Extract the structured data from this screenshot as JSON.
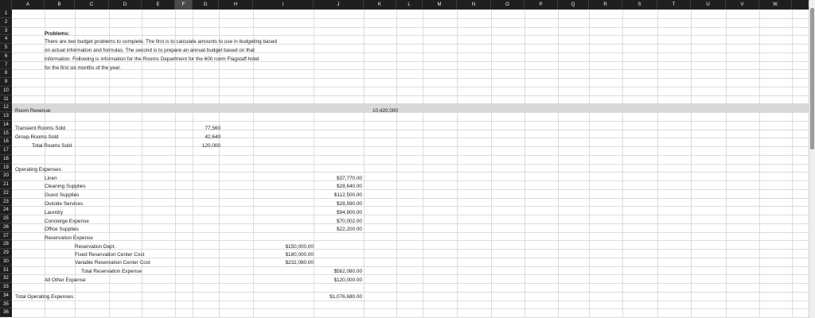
{
  "columns": [
    "A",
    "B",
    "C",
    "D",
    "E",
    "F",
    "G",
    "H",
    "I",
    "J",
    "K",
    "L",
    "M",
    "N",
    "O",
    "P",
    "Q",
    "R",
    "S",
    "T",
    "U",
    "V",
    "W",
    "X"
  ],
  "selected_column": "F",
  "rows": [
    "1",
    "2",
    "3",
    "4",
    "5",
    "6",
    "7",
    "8",
    "9",
    "10",
    "11",
    "12",
    "13",
    "14",
    "15",
    "16",
    "17",
    "18",
    "19",
    "20",
    "21",
    "22",
    "23",
    "24",
    "25",
    "26",
    "27",
    "28",
    "29",
    "30",
    "31",
    "32",
    "33",
    "34",
    "35",
    "36"
  ],
  "problem": {
    "heading": "Problems:",
    "line1": "There are two budget problems to complete. The first is to calculate amounts to use in budgeting based",
    "line2": "on actual information and formulas. The second is to prepare an annual budget based on that",
    "line3": "information. Following is information for the Rooms Department for the 600 room Flagstaff hotel",
    "line4": "for the first six months of the year."
  },
  "room_revenue": {
    "label": "Room Revenue",
    "value": "10,420,000"
  },
  "rooms": {
    "transient_label": "Transient Rooms Sold",
    "transient_value": "77,560",
    "group_label": "Group Rooms Sold",
    "group_value": "42,640",
    "total_label": "Total Rooms Sold",
    "total_value": "120,000"
  },
  "expenses": {
    "heading": "Operating Expenses",
    "linen_label": "Linen",
    "linen_value": "$37,770.00",
    "cleaning_label": "Cleaning Supplies",
    "cleaning_value": "$28,640.00",
    "guest_label": "Guest Supplies",
    "guest_value": "$112,500.00",
    "outside_label": "Outside Services",
    "outside_value": "$28,590.00",
    "laundry_label": "Laundry",
    "laundry_value": "$94,800.00",
    "concierge_label": "Concierge Expense",
    "concierge_value": "$70,002.00",
    "office_label": "Office Supplies",
    "office_value": "$22,200.00",
    "reservation_label": "Reservation Expense",
    "res_dept_label": "Reservation Dept.",
    "res_dept_value": "$150,000.00",
    "fixed_res_label": "Fixed Reservation Center Cost",
    "fixed_res_value": "$180,000.00",
    "var_res_label": "Variable Reservation Center Cost",
    "var_res_value": "$232,080.00",
    "total_res_label": "Total Reservation Expense",
    "total_res_value": "$562,080.00",
    "other_label": "All Other Expense",
    "other_value": "$120,000.00",
    "total_label": "Total Operating Expenses",
    "total_value": "$1,076,680.00"
  }
}
